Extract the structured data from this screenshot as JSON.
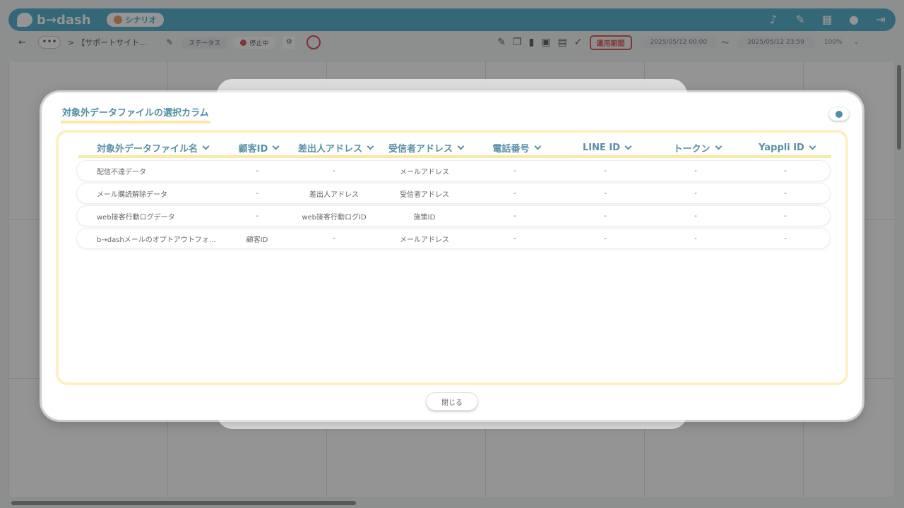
{
  "app": {
    "brand": "b→dash",
    "scenario_label": "シナリオ",
    "top_icons": [
      "bell-icon",
      "wrench-icon",
      "grid-icon",
      "support-icon",
      "logout-icon"
    ]
  },
  "toolbar": {
    "back": "←",
    "more": "•••",
    "separator": ">",
    "title": "【サポートサイト…",
    "status_label": "ステータス",
    "stopped_label": "停止中",
    "period_label": "運用期間",
    "date_from": "2025/05/12 00:00",
    "tilde": "〜",
    "date_to": "2025/05/12 23:59",
    "zoom": "100%"
  },
  "modal": {
    "title": "対象外データファイルの選択カラム",
    "close_label": "閉じる",
    "columns": [
      "対象外データファイル名",
      "顧客ID",
      "差出人アドレス",
      "受信者アドレス",
      "電話番号",
      "LINE ID",
      "トークン",
      "Yappli ID"
    ],
    "rows": [
      [
        "配信不達データ",
        "-",
        "-",
        "メールアドレス",
        "-",
        "-",
        "-",
        "-"
      ],
      [
        "メール購読解除データ",
        "-",
        "差出人アドレス",
        "受信者アドレス",
        "-",
        "-",
        "-",
        "-"
      ],
      [
        "web接客行動ログデータ",
        "-",
        "web接客行動ログID",
        "施策ID",
        "-",
        "-",
        "-",
        "-"
      ],
      [
        "b→dashメールのオプトアウトフォ…",
        "顧客ID",
        "-",
        "メールアドレス",
        "-",
        "-",
        "-",
        "-"
      ]
    ]
  },
  "colors": {
    "brand_blue": "#5ab3cf",
    "header_text": "#5a8fa6",
    "highlight_yellow": "#fbe7a6",
    "alert_red": "#e06060"
  }
}
